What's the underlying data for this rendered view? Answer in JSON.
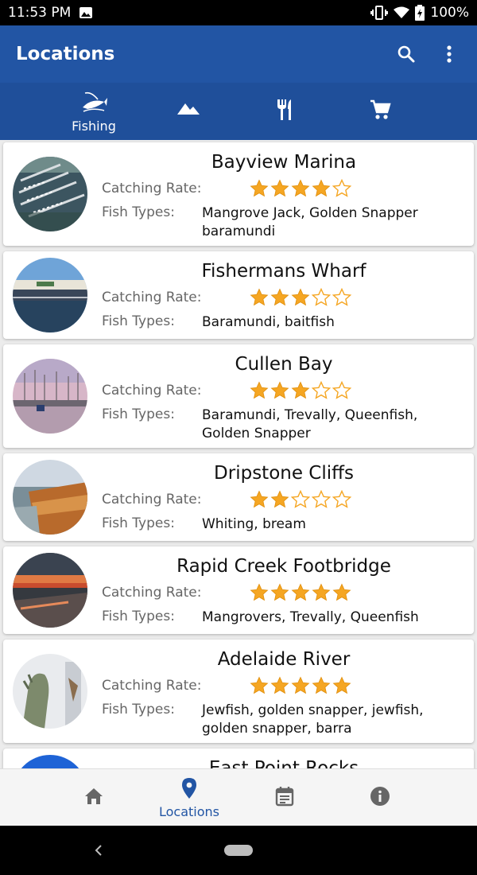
{
  "status_bar": {
    "time": "11:53 PM",
    "battery": "100%"
  },
  "app_bar": {
    "title": "Locations",
    "actions": [
      "search-icon",
      "more-vert-icon"
    ]
  },
  "category_tabs": [
    {
      "label": "Fishing",
      "icon": "fishing-icon",
      "selected": true
    },
    {
      "label": "",
      "icon": "mountain-icon"
    },
    {
      "label": "",
      "icon": "restaurant-icon"
    },
    {
      "label": "",
      "icon": "shopping-cart-icon"
    }
  ],
  "list_labels": {
    "catching_rate": "Catching Rate:",
    "fish_types": "Fish Types:"
  },
  "locations": [
    {
      "name": "Bayview Marina",
      "rating": 4,
      "fish_types": "Mangrove Jack,  Golden Snapper baramundi"
    },
    {
      "name": "Fishermans Wharf",
      "rating": 3,
      "fish_types": "Baramundi, baitfish"
    },
    {
      "name": "Cullen Bay",
      "rating": 3,
      "fish_types": "Baramundi, Trevally, Queenfish, Golden Snapper"
    },
    {
      "name": "Dripstone Cliffs",
      "rating": 2,
      "fish_types": "Whiting, bream"
    },
    {
      "name": "Rapid Creek Footbridge",
      "rating": 5,
      "fish_types": "Mangrovers, Trevally, Queenfish"
    },
    {
      "name": "Adelaide River",
      "rating": 5,
      "fish_types": "Jewfish, golden snapper, jewfish, golden snapper, barra"
    },
    {
      "name": "East Point Rocks"
    }
  ],
  "bottom_nav": [
    {
      "label": "",
      "icon": "home-icon"
    },
    {
      "label": "Locations",
      "icon": "location-pin-icon",
      "active": true
    },
    {
      "label": "",
      "icon": "calendar-icon"
    },
    {
      "label": "",
      "icon": "info-icon"
    }
  ],
  "colors": {
    "app_bar": "#2255a4",
    "tabs": "#1f4f9a",
    "star": "#f5a623",
    "star_empty": "#f5a623"
  }
}
